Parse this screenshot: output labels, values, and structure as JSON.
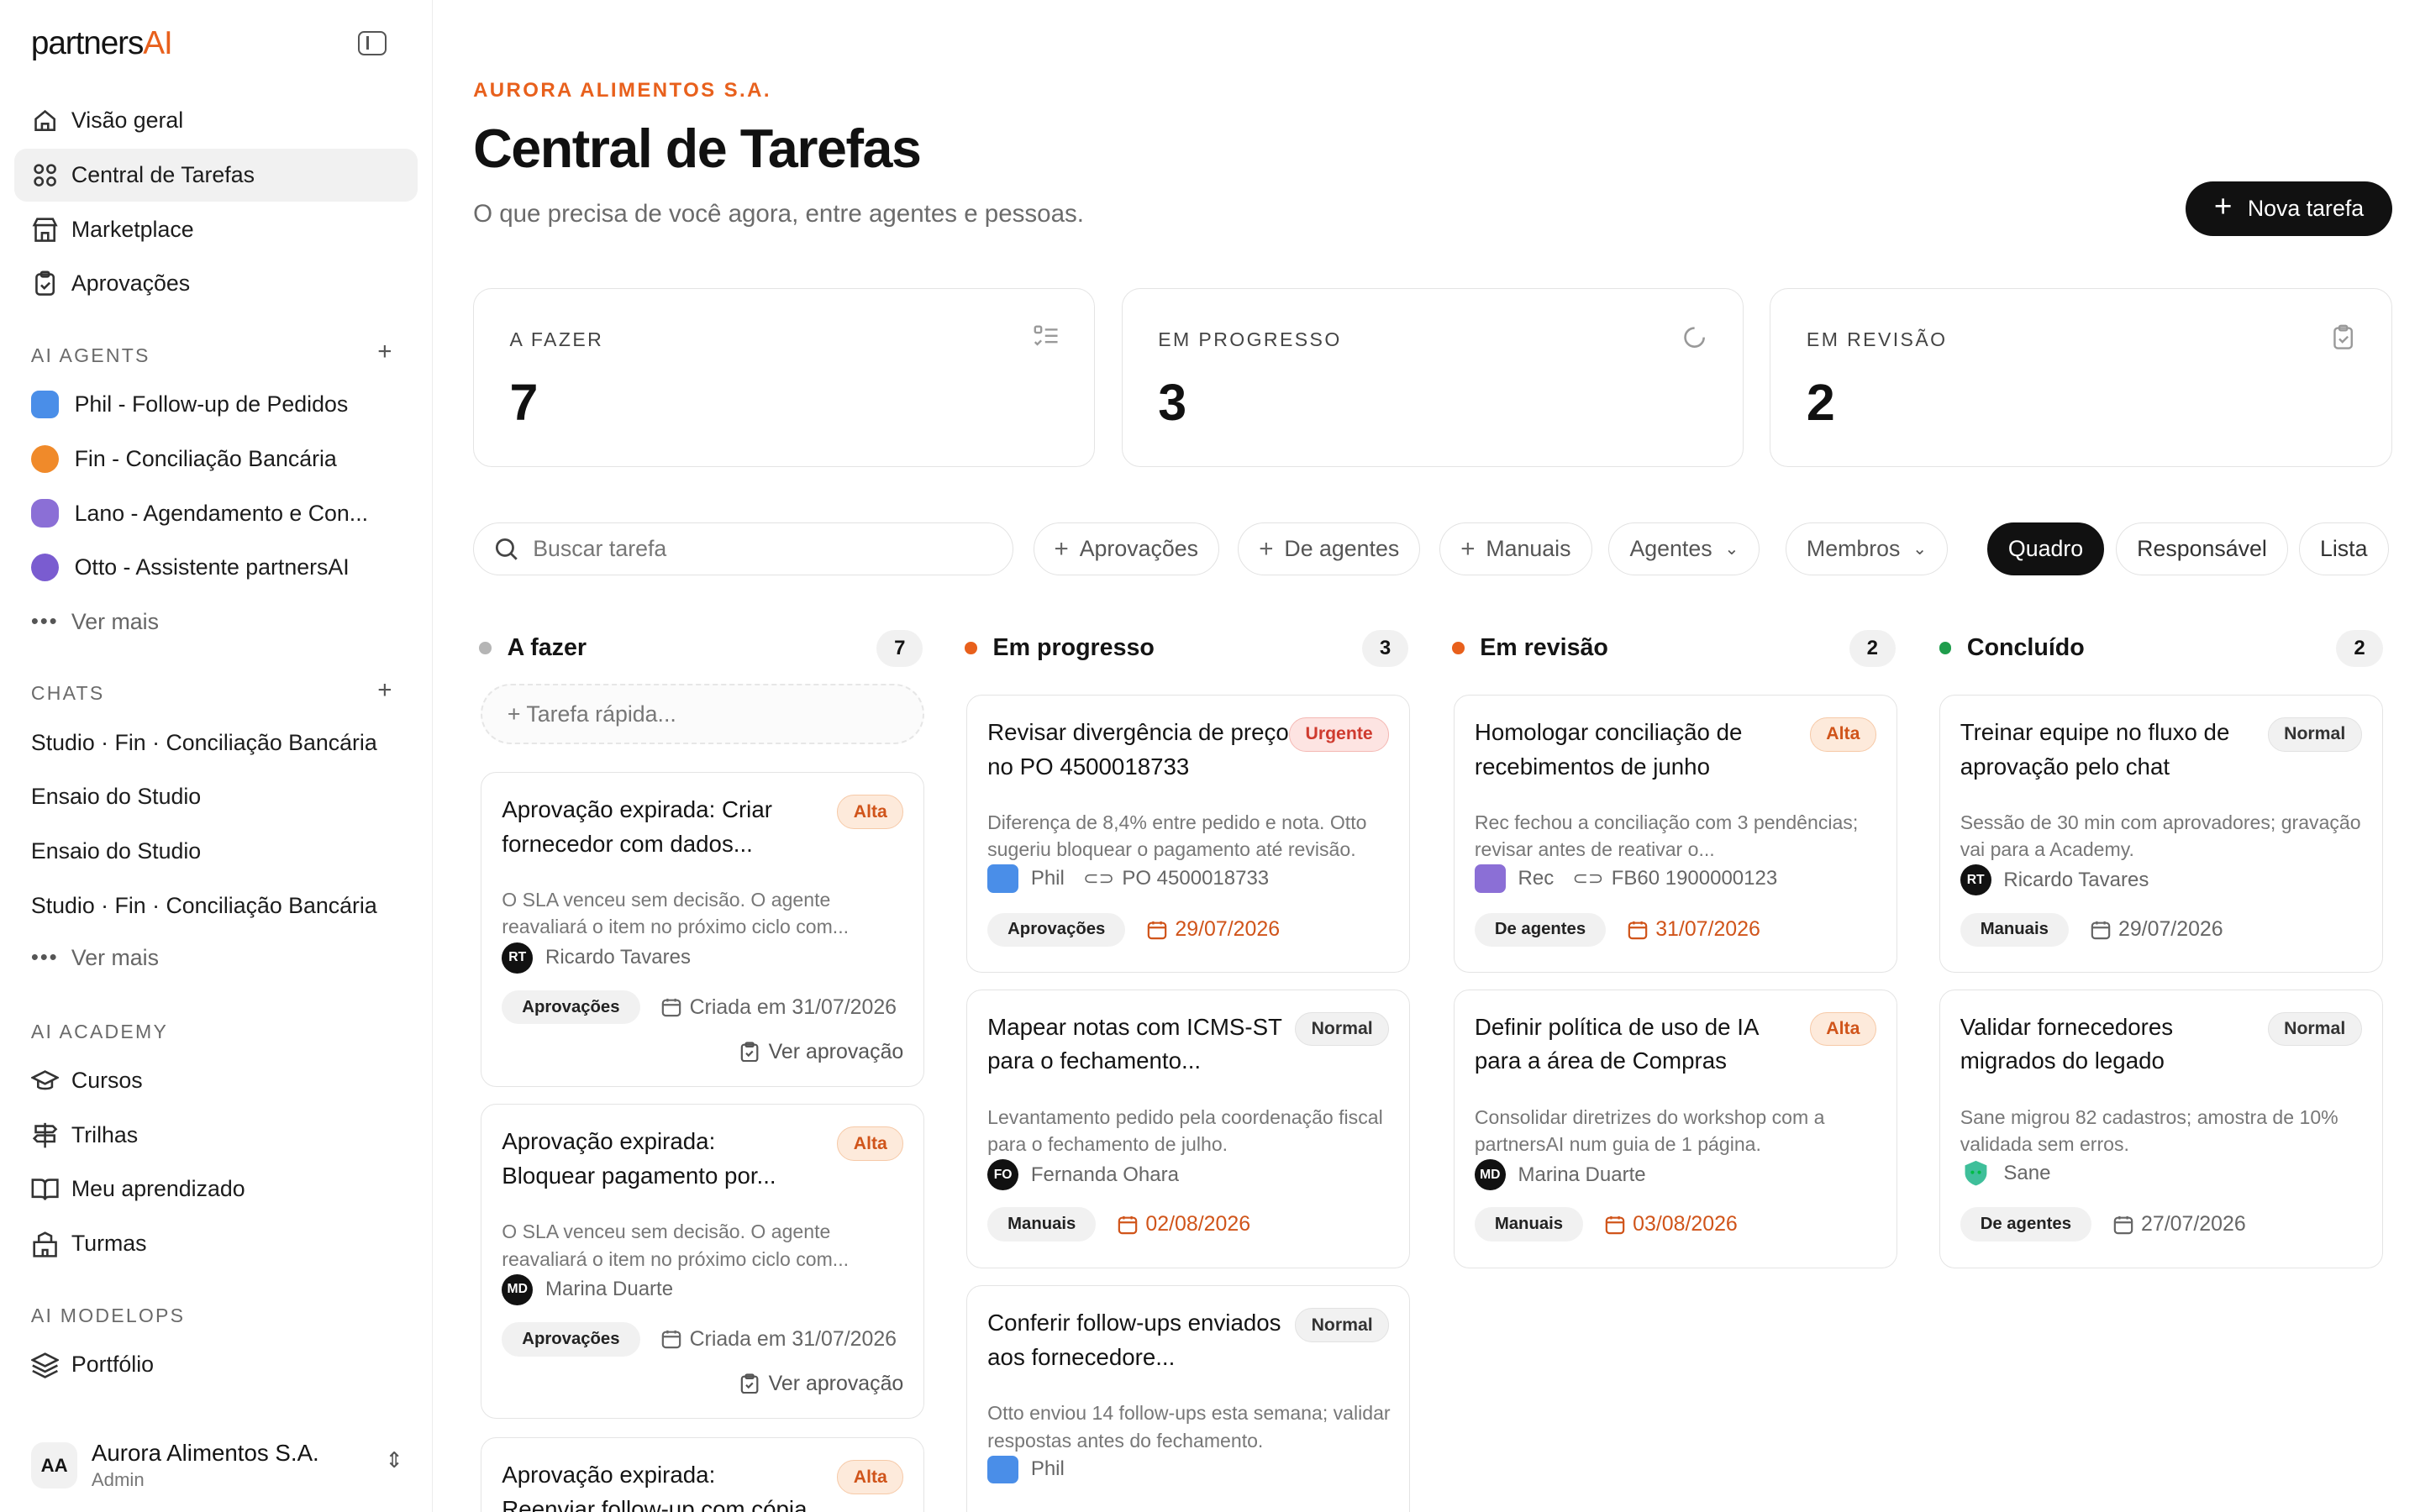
{
  "app": {
    "logo_text": "partners",
    "logo_accent": "AI"
  },
  "sidebar": {
    "nav": [
      {
        "label": "Visão geral",
        "icon": "home-icon"
      },
      {
        "label": "Central de Tarefas",
        "icon": "grid-icon",
        "active": true
      },
      {
        "label": "Marketplace",
        "icon": "store-icon"
      },
      {
        "label": "Aprovações",
        "icon": "clipboard-icon"
      }
    ],
    "agents_title": "AI AGENTS",
    "agents": [
      {
        "label": "Phil - Follow-up de Pedidos",
        "color": "#4a8ee8"
      },
      {
        "label": "Fin - Conciliação Bancária",
        "color": "#f08a2a"
      },
      {
        "label": "Lano - Agendamento e Con...",
        "color": "#8b6fd6"
      },
      {
        "label": "Otto - Assistente partnersAI",
        "color": "#7a5cd0"
      }
    ],
    "agents_more": "Ver mais",
    "chats_title": "CHATS",
    "chats": [
      "Studio · Fin · Conciliação Bancária",
      "Ensaio do Studio",
      "Ensaio do Studio",
      "Studio · Fin · Conciliação Bancária"
    ],
    "chats_more": "Ver mais",
    "academy_title": "AI ACADEMY",
    "academy": [
      "Cursos",
      "Trilhas",
      "Meu aprendizado",
      "Turmas"
    ],
    "modelops_title": "AI MODELOPS",
    "modelops": [
      "Portfólio"
    ],
    "org": {
      "initials": "AA",
      "name": "Aurora Alimentos S.A.",
      "role": "Admin"
    }
  },
  "header": {
    "org_label": "AURORA ALIMENTOS S.A.",
    "title": "Central de Tarefas",
    "subtitle": "O que precisa de você agora, entre agentes e pessoas.",
    "new_task": "Nova tarefa"
  },
  "stats": [
    {
      "label": "A FAZER",
      "value": "7"
    },
    {
      "label": "EM PROGRESSO",
      "value": "3"
    },
    {
      "label": "EM REVISÃO",
      "value": "2"
    }
  ],
  "filters": {
    "search_placeholder": "Buscar tarefa",
    "chips": [
      "Aprovações",
      "De agentes",
      "Manuais"
    ],
    "dropdowns": [
      "Agentes",
      "Membros"
    ],
    "views": [
      "Quadro",
      "Responsável",
      "Lista"
    ],
    "active_view": "Quadro"
  },
  "colors": {
    "accent": "#e8601c",
    "todo": "#b5b5b5",
    "progress": "#e8601c",
    "review": "#e8601c",
    "done": "#1f9d4c"
  },
  "board": {
    "quick_add": "+ Tarefa rápida...",
    "columns": [
      {
        "title": "A fazer",
        "count": "7",
        "cards": [
          {
            "title": "Aprovação expirada: Criar fornecedor com dados...",
            "priority": "Alta",
            "desc": "O SLA venceu sem decisão. O agente reavaliará o item no próximo ciclo com...",
            "person": "Ricardo Tavares",
            "initials": "RT",
            "tag": "Aprovações",
            "date": "Criada em 31/07/2026",
            "link": "Ver aprovação"
          },
          {
            "title": "Aprovação expirada: Bloquear pagamento por...",
            "priority": "Alta",
            "desc": "O SLA venceu sem decisão. O agente reavaliará o item no próximo ciclo com...",
            "person": "Marina Duarte",
            "initials": "MD",
            "tag": "Aprovações",
            "date": "Criada em 31/07/2026",
            "link": "Ver aprovação"
          },
          {
            "title": "Aprovação expirada: Reenviar follow-up com cópia à...",
            "priority": "Alta"
          }
        ]
      },
      {
        "title": "Em progresso",
        "count": "3",
        "cards": [
          {
            "title": "Revisar divergência de preço no PO 4500018733",
            "priority": "Urgente",
            "desc": "Diferença de 8,4% entre pedido e nota. Otto sugeriu bloquear o pagamento até revisão.",
            "person": "Phil",
            "ref": "PO 4500018733",
            "tag": "Aprovações",
            "date": "29/07/2026"
          },
          {
            "title": "Mapear notas com ICMS-ST para o fechamento...",
            "priority": "Normal",
            "desc": "Levantamento pedido pela coordenação fiscal para o fechamento de julho.",
            "person": "Fernanda Ohara",
            "initials": "FO",
            "tag": "Manuais",
            "date": "02/08/2026"
          },
          {
            "title": "Conferir follow-ups enviados aos fornecedore...",
            "priority": "Normal",
            "desc": "Otto enviou 14 follow-ups esta semana; validar respostas antes do fechamento.",
            "person": "Phil"
          }
        ]
      },
      {
        "title": "Em revisão",
        "count": "2",
        "cards": [
          {
            "title": "Homologar conciliação de recebimentos de junho",
            "priority": "Alta",
            "desc": "Rec fechou a conciliação com 3 pendências; revisar antes de reativar o...",
            "person": "Rec",
            "ref": "FB60 1900000123",
            "tag": "De agentes",
            "date": "31/07/2026"
          },
          {
            "title": "Definir política de uso de IA para a área de Compras",
            "priority": "Alta",
            "desc": "Consolidar diretrizes do workshop com a partnersAI num guia de 1 página.",
            "person": "Marina Duarte",
            "initials": "MD",
            "tag": "Manuais",
            "date": "03/08/2026"
          }
        ]
      },
      {
        "title": "Concluído",
        "count": "2",
        "cards": [
          {
            "title": "Treinar equipe no fluxo de aprovação pelo chat",
            "priority": "Normal",
            "desc": "Sessão de 30 min com aprovadores; gravação vai para a Academy.",
            "person": "Ricardo Tavares",
            "initials": "RT",
            "tag": "Manuais",
            "date": "29/07/2026"
          },
          {
            "title": "Validar fornecedores migrados do legado",
            "priority": "Normal",
            "desc": "Sane migrou 82 cadastros; amostra de 10% validada sem erros.",
            "person": "Sane",
            "tag": "De agentes",
            "date": "27/07/2026"
          }
        ]
      }
    ]
  }
}
